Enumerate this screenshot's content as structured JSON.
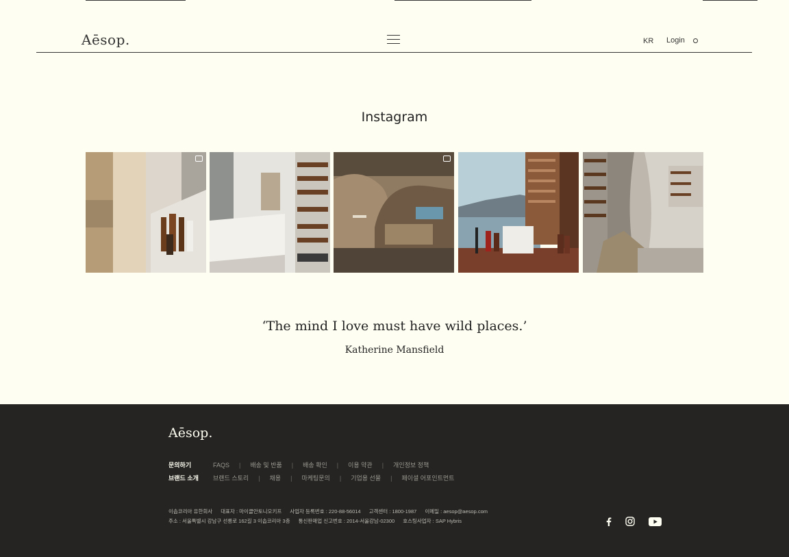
{
  "header": {
    "logo": "Aēsop.",
    "lang": "KR",
    "login": "Login"
  },
  "instagram": {
    "title": "Instagram"
  },
  "quote": {
    "text": "‘The mind I love must have wild places.’",
    "author": "Katherine Mansfield"
  },
  "footer": {
    "logo": "Aēsop.",
    "row1": {
      "head": "문의하기",
      "links": [
        "FAQS",
        "배송 및 반품",
        "배송 확인",
        "이용 약관",
        "개인정보 정책"
      ]
    },
    "row2": {
      "head": "브랜드 소개",
      "links": [
        "브랜드 스토리",
        "채용",
        "마케팅문의",
        "기업용 선물",
        "페이셜 어포인트먼트"
      ]
    },
    "info1": [
      "이솝코리아 유한회사",
      "대표자 : 마이클안토니오키프",
      "사업자 등록번호 : 220-88-56014",
      "고객센터 : 1800-1987",
      "이메일 : aesop@aesop.com"
    ],
    "info2": [
      "주소 : 서울특별시 강남구 선릉로 162길 3 이솝코리아 3층",
      "통신판매업 신고번호 : 2014-서울강남-02300",
      "호스팅사업자 : SAP Hybris"
    ]
  },
  "colors": {
    "background": "#fffef2",
    "footer_bg": "#252422",
    "text": "#333333"
  },
  "icons": [
    "menu-icon",
    "search-icon",
    "video-icon",
    "gallery-icon",
    "facebook-icon",
    "instagram-icon",
    "youtube-icon"
  ]
}
